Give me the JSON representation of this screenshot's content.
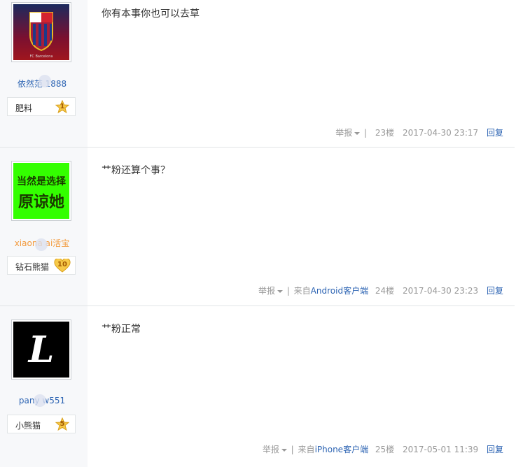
{
  "posts": [
    {
      "username": "依然范  1888",
      "badge_name": "肥料",
      "badge_level": "1",
      "content": "你有本事你也可以去草",
      "report": "举报",
      "source": "",
      "floor": "23楼",
      "time": "2017-04-30 23:17",
      "reply": "回复",
      "avatar_icon": "fc-barcelona-crest-icon"
    },
    {
      "username": "xiaona  ai活宝",
      "badge_name": "钻石熊猫",
      "badge_level": "10",
      "content": "艹粉还算个事？",
      "report": "举报",
      "source_prefix": "来自",
      "source_link": "Android客户端",
      "floor": "24楼",
      "time": "2017-04-30 23:23",
      "reply": "回复",
      "avatar_line1": "当然是选择",
      "avatar_line2": "原谅她"
    },
    {
      "username": "pany  w551",
      "badge_name": "小熊猫",
      "badge_level": "5",
      "content": "艹粉正常",
      "report": "举报",
      "source_prefix": "来自",
      "source_link": "iPhone客户端",
      "floor": "25楼",
      "time": "2017-05-01 11:39",
      "reply": "回复",
      "avatar_letter": "L"
    }
  ],
  "colors": {
    "link": "#2d64b3",
    "orange_name": "#f39a3c",
    "avatar_green": "#33ff00"
  }
}
